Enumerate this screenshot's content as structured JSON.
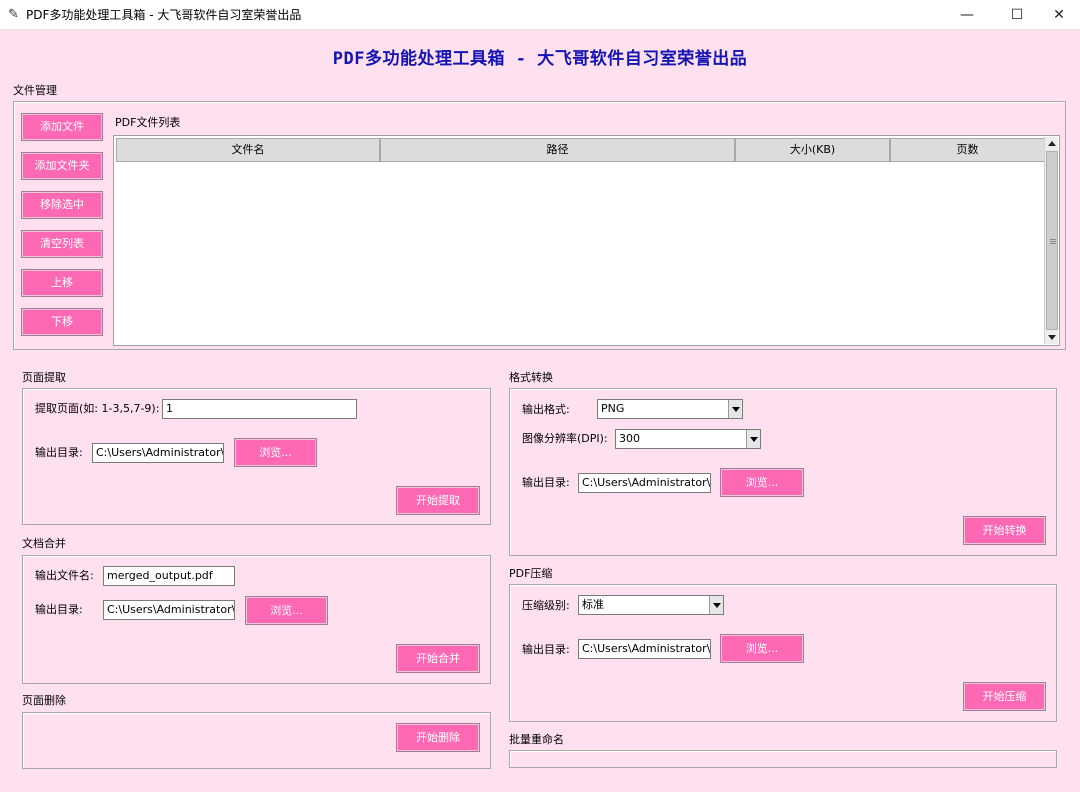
{
  "window": {
    "title": "PDF多功能处理工具箱 - 大飞哥软件自习室荣誉出品",
    "minimize": "—",
    "maximize": "☐",
    "close": "✕"
  },
  "app_title": "PDF多功能处理工具箱 - 大飞哥软件自习室荣誉出品",
  "file_management": {
    "label": "文件管理",
    "buttons": [
      "添加文件",
      "添加文件夹",
      "移除选中",
      "清空列表",
      "上移",
      "下移"
    ],
    "list_label": "PDF文件列表",
    "columns": [
      "文件名",
      "路径",
      "大小(KB)",
      "页数"
    ]
  },
  "page_extract": {
    "label": "页面提取",
    "pages_label": "提取页面(如: 1-3,5,7-9):",
    "pages_value": "1",
    "outdir_label": "输出目录:",
    "outdir_value": "C:\\Users\\Administrator\\",
    "browse": "浏览...",
    "start": "开始提取"
  },
  "merge": {
    "label": "文档合并",
    "filename_label": "输出文件名:",
    "filename_value": "merged_output.pdf",
    "outdir_label": "输出目录:",
    "outdir_value": "C:\\Users\\Administrator\\",
    "browse": "浏览...",
    "start": "开始合并"
  },
  "delete": {
    "label": "页面删除",
    "start": "开始删除"
  },
  "convert": {
    "label": "格式转换",
    "format_label": "输出格式:",
    "format_value": "PNG",
    "dpi_label": "图像分辨率(DPI):",
    "dpi_value": "300",
    "outdir_label": "输出目录:",
    "outdir_value": "C:\\Users\\Administrator\\",
    "browse": "浏览...",
    "start": "开始转换"
  },
  "compress": {
    "label": "PDF压缩",
    "level_label": "压缩级别:",
    "level_value": "标准",
    "outdir_label": "输出目录:",
    "outdir_value": "C:\\Users\\Administrator\\",
    "browse": "浏览...",
    "start": "开始压缩"
  },
  "rename": {
    "label": "批量重命名"
  },
  "colors": {
    "background": "#ffe0ef",
    "button": "#ff69b4",
    "title": "#1414b4"
  },
  "icons": [
    "feather-icon",
    "minimize-icon",
    "maximize-icon",
    "close-icon",
    "chevron-down-icon"
  ]
}
